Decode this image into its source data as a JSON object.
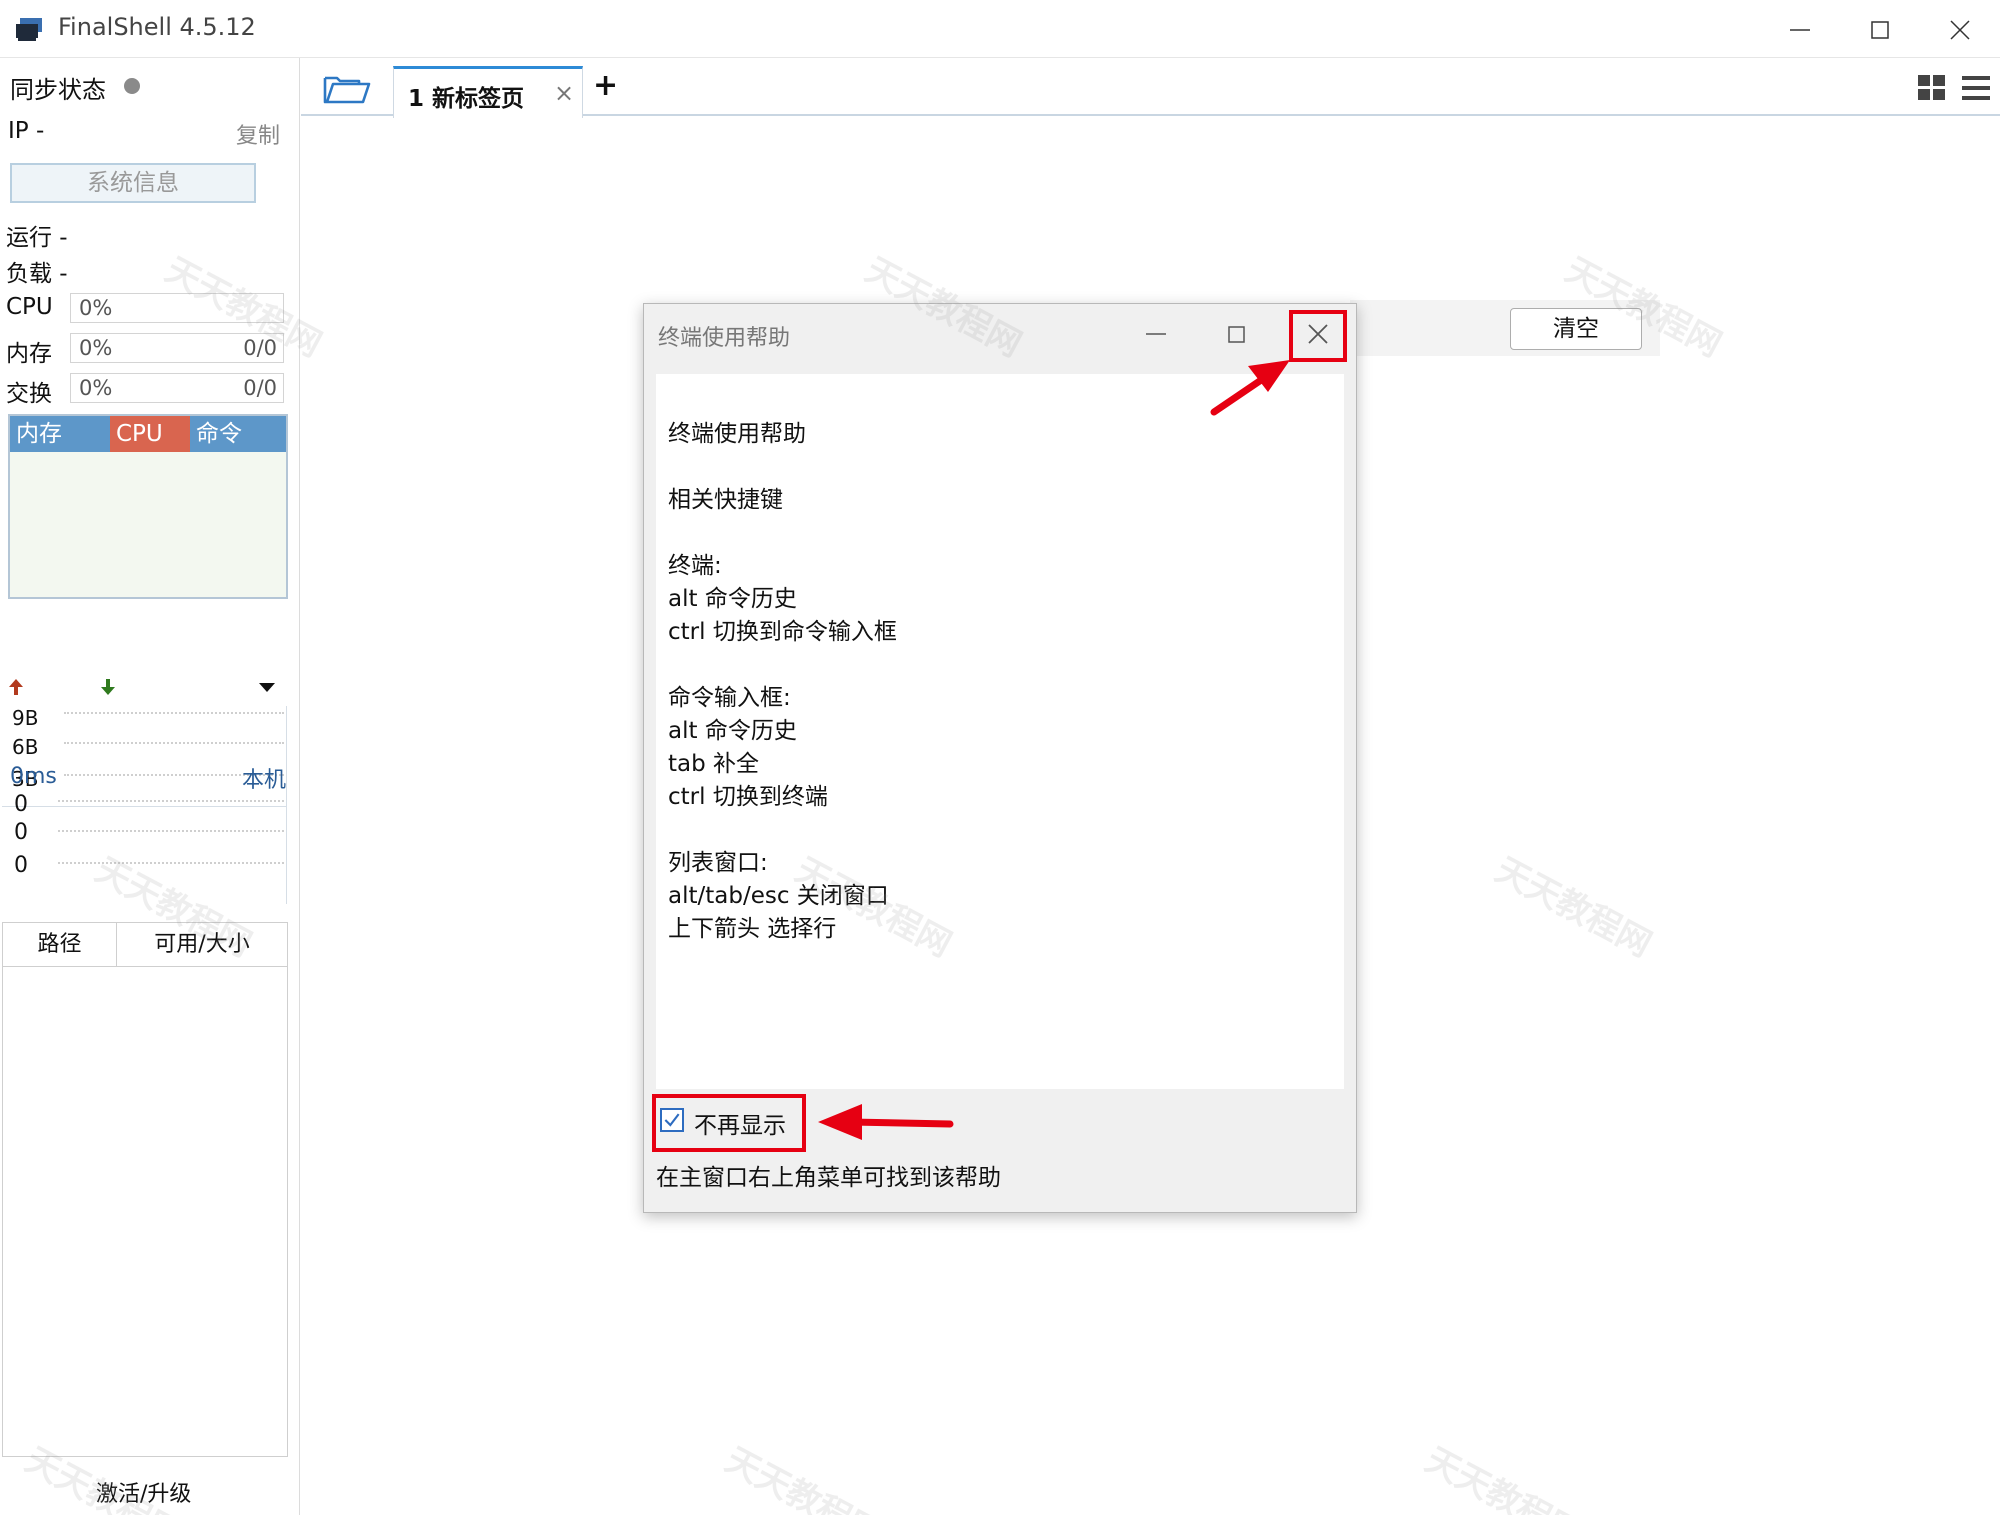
{
  "window": {
    "title": "FinalShell 4.5.12"
  },
  "sidebar": {
    "sync_label": "同步状态",
    "ip_label": "IP   -",
    "copy_label": "复制",
    "sysinfo_button": "系统信息",
    "run_label": "运行 -",
    "load_label": "负载 -",
    "cpu": {
      "label": "CPU",
      "pct": "0%",
      "frac": ""
    },
    "mem": {
      "label": "内存",
      "pct": "0%",
      "frac": "0/0"
    },
    "swap": {
      "label": "交换",
      "pct": "0%",
      "frac": "0/0"
    },
    "proc_tabs": [
      "内存",
      "CPU",
      "命令"
    ],
    "net_scale": [
      "9B",
      "6B",
      "3B"
    ],
    "ping_ms": "0ms",
    "ping_target": "本机",
    "ping_values": [
      "0",
      "0",
      "0"
    ],
    "fs_columns": [
      "路径",
      "可用/大小"
    ],
    "activate_label": "激活/升级"
  },
  "tabs": [
    {
      "label": "1 新标签页"
    }
  ],
  "main": {
    "clear_button": "清空"
  },
  "dialog": {
    "title": "终端使用帮助",
    "lines": [
      "终端使用帮助",
      "相关快捷键",
      "终端:",
      "alt 命令历史",
      "ctrl 切换到命令输入框",
      "命令输入框:",
      "alt 命令历史",
      "tab 补全",
      "ctrl 切换到终端",
      "列表窗口:",
      "alt/tab/esc 关闭窗口",
      "上下箭头 选择行"
    ],
    "noshow_label": "不再显示",
    "noshow_checked": true,
    "hint": "在主窗口右上角菜单可找到该帮助"
  },
  "colors": {
    "accent_red": "#e60012",
    "proc_header_blue": "#5d97c9",
    "cpu_tab_red": "#d9654f",
    "tab_active_blue": "#2d8ad6"
  },
  "watermark_text": "天天教程网"
}
